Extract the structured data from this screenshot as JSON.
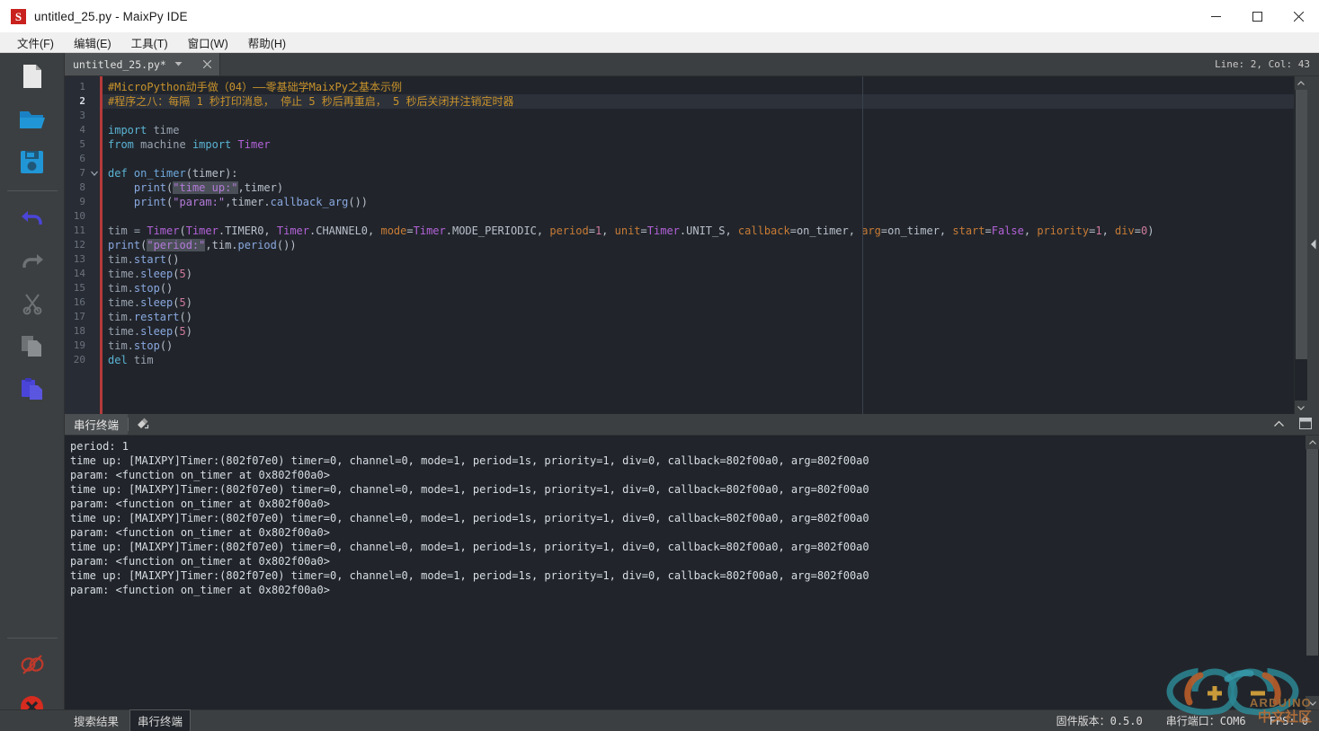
{
  "window": {
    "title": "untitled_25.py - MaixPy IDE",
    "logo_letter": "S",
    "controls": [
      {
        "name": "minimize-button",
        "icon": "minimize-icon"
      },
      {
        "name": "maximize-button",
        "icon": "maximize-icon"
      },
      {
        "name": "close-button",
        "icon": "close-icon"
      }
    ]
  },
  "menubar": {
    "items": [
      {
        "label": "文件(F)",
        "name": "menu-file"
      },
      {
        "label": "编辑(E)",
        "name": "menu-edit"
      },
      {
        "label": "工具(T)",
        "name": "menu-tools"
      },
      {
        "label": "窗口(W)",
        "name": "menu-window"
      },
      {
        "label": "帮助(H)",
        "name": "menu-help"
      }
    ]
  },
  "toolbar": {
    "items": [
      {
        "name": "new-file-icon",
        "title": "New File"
      },
      {
        "name": "open-folder-icon",
        "title": "Open File"
      },
      {
        "name": "save-file-icon",
        "title": "Save File"
      },
      {
        "name": "undo-icon",
        "title": "Undo"
      },
      {
        "name": "redo-icon",
        "title": "Redo"
      },
      {
        "name": "cut-icon",
        "title": "Cut"
      },
      {
        "name": "copy-icon",
        "title": "Copy"
      },
      {
        "name": "paste-icon",
        "title": "Paste"
      }
    ],
    "bottom_items": [
      {
        "name": "disconnect-icon",
        "title": "Disconnect"
      },
      {
        "name": "stop-icon",
        "title": "Stop"
      }
    ]
  },
  "editor": {
    "tab_label": "untitled_25.py*",
    "dropdown_icon": "chevron-down-icon",
    "close_icon": "close-icon",
    "line_col": "Line: 2, Col: 43",
    "current_line": 2,
    "line_numbers": [
      1,
      2,
      3,
      4,
      5,
      6,
      7,
      8,
      9,
      10,
      11,
      12,
      13,
      14,
      15,
      16,
      17,
      18,
      19,
      20
    ],
    "lines": [
      "#MicroPython动手做（04）——零基础学MaixPy之基本示例",
      "#程序之八：每隔 1 秒打印消息， 停止 5 秒后再重启， 5 秒后关闭并注销定时器",
      "",
      "import time",
      "from machine import Timer",
      "",
      "def on_timer(timer):",
      "    print(\"time up:\",timer)",
      "    print(\"param:\",timer.callback_arg())",
      "",
      "tim = Timer(Timer.TIMER0, Timer.CHANNEL0, mode=Timer.MODE_PERIODIC, period=1, unit=Timer.UNIT_S, callback=on_timer, arg=on_timer, start=False, priority=1, div=0)",
      "print(\"period:\",tim.period())",
      "tim.start()",
      "time.sleep(5)",
      "tim.stop()",
      "time.sleep(5)",
      "tim.restart()",
      "time.sleep(5)",
      "tim.stop()",
      "del tim"
    ]
  },
  "terminal": {
    "title": "串行终端",
    "clear_icon": "clear-terminal-icon",
    "collapse_icon": "chevron-up-icon",
    "undock_icon": "undock-panel-icon",
    "output": [
      "period: 1",
      "time up: [MAIXPY]Timer:(802f07e0) timer=0, channel=0, mode=1, period=1s, priority=1, div=0, callback=802f00a0, arg=802f00a0",
      "param: <function on_timer at 0x802f00a0>",
      "time up: [MAIXPY]Timer:(802f07e0) timer=0, channel=0, mode=1, period=1s, priority=1, div=0, callback=802f00a0, arg=802f00a0",
      "param: <function on_timer at 0x802f00a0>",
      "time up: [MAIXPY]Timer:(802f07e0) timer=0, channel=0, mode=1, period=1s, priority=1, div=0, callback=802f00a0, arg=802f00a0",
      "param: <function on_timer at 0x802f00a0>",
      "time up: [MAIXPY]Timer:(802f07e0) timer=0, channel=0, mode=1, period=1s, priority=1, div=0, callback=802f00a0, arg=802f00a0",
      "param: <function on_timer at 0x802f00a0>",
      "time up: [MAIXPY]Timer:(802f07e0) timer=0, channel=0, mode=1, period=1s, priority=1, div=0, callback=802f00a0, arg=802f00a0",
      "param: <function on_timer at 0x802f00a0>"
    ]
  },
  "statusbar": {
    "tabs": [
      {
        "label": "搜索结果",
        "name": "status-tab-search-results",
        "active": false
      },
      {
        "label": "串行终端",
        "name": "status-tab-serial-terminal",
        "active": true
      }
    ],
    "firmware": "固件版本：0.5.0",
    "serial_port": "串行端口：COM6",
    "fps": "FPS: 0"
  },
  "watermark": {
    "line1": "ARDUINO",
    "line2": "中文社区"
  },
  "colors": {
    "accent_blue": "#2196d6",
    "comment": "#c8922c",
    "keyword": "#5bb3d4",
    "class": "#b362d8",
    "string": "#b37ad8",
    "number": "#d07a9e",
    "argument": "#c87b36",
    "editor_bg": "#21252b",
    "chrome_bg": "#3c3f41",
    "error_red": "#cc2222"
  }
}
